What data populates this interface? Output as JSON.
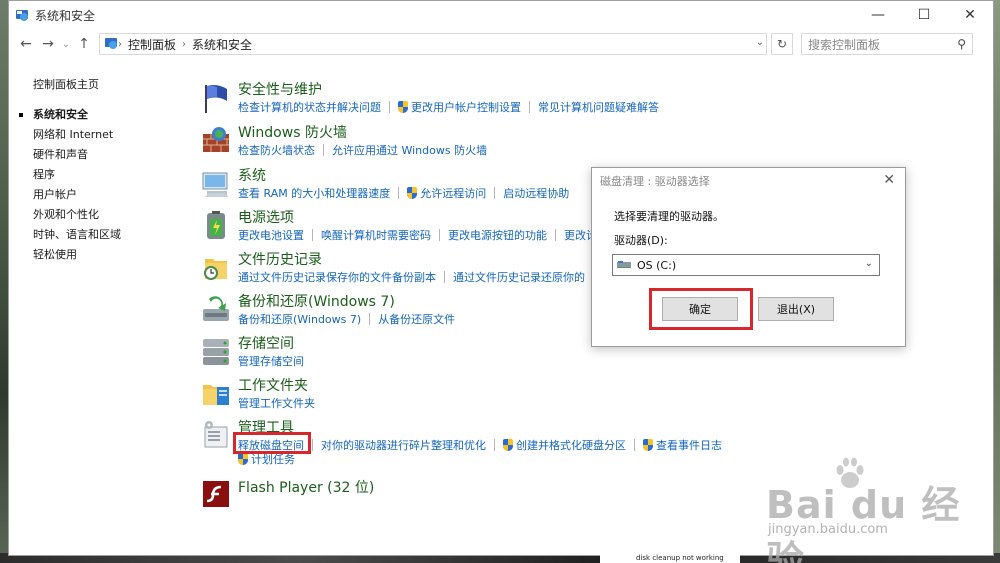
{
  "window": {
    "title": "系统和安全",
    "controls": {
      "minimize": "—",
      "maximize": "☐",
      "close": "✕"
    }
  },
  "navbar": {
    "breadcrumb": [
      "控制面板",
      "系统和安全"
    ],
    "search_placeholder": "搜索控制面板"
  },
  "sidebar": {
    "home": "控制面板主页",
    "items": [
      "系统和安全",
      "网络和 Internet",
      "硬件和声音",
      "程序",
      "用户帐户",
      "外观和个性化",
      "时钟、语言和区域",
      "轻松使用"
    ],
    "current": "系统和安全"
  },
  "categories": [
    {
      "title": "安全性与维护",
      "links": [
        "检查计算机的状态并解决问题",
        "更改用户帐户控制设置",
        "常见计算机问题疑难解答"
      ]
    },
    {
      "title": "Windows 防火墙",
      "links": [
        "检查防火墙状态",
        "允许应用通过 Windows 防火墙"
      ]
    },
    {
      "title": "系统",
      "links": [
        "查看 RAM 的大小和处理器速度",
        "允许远程访问",
        "启动远程协助"
      ]
    },
    {
      "title": "电源选项",
      "links": [
        "更改电池设置",
        "唤醒计算机时需要密码",
        "更改电源按钮的功能",
        "更改计"
      ]
    },
    {
      "title": "文件历史记录",
      "links": [
        "通过文件历史记录保存你的文件备份副本",
        "通过文件历史记录还原你的"
      ]
    },
    {
      "title": "备份和还原(Windows 7)",
      "links": [
        "备份和还原(Windows 7)",
        "从备份还原文件"
      ]
    },
    {
      "title": "存储空间",
      "links": [
        "管理存储空间"
      ]
    },
    {
      "title": "工作文件夹",
      "links": [
        "管理工作文件夹"
      ]
    },
    {
      "title": "管理工具",
      "links": [
        "释放磁盘空间",
        "对你的驱动器进行碎片整理和优化",
        "创建并格式化硬盘分区",
        "查看事件日志"
      ],
      "sublink": "计划任务"
    },
    {
      "title": "Flash Player (32 位)",
      "links": []
    }
  ],
  "dialog": {
    "title": "磁盘清理 : 驱动器选择",
    "prompt": "选择要清理的驱动器。",
    "drive_label": "驱动器(D):",
    "drive_value": "OS (C:)",
    "ok_label": "确定",
    "exit_label": "退出(X)"
  },
  "watermark": {
    "text": "Bai du 经验",
    "sub": "jingyan.baidu.com"
  },
  "taskbar_snip": "disk cleanup not working"
}
